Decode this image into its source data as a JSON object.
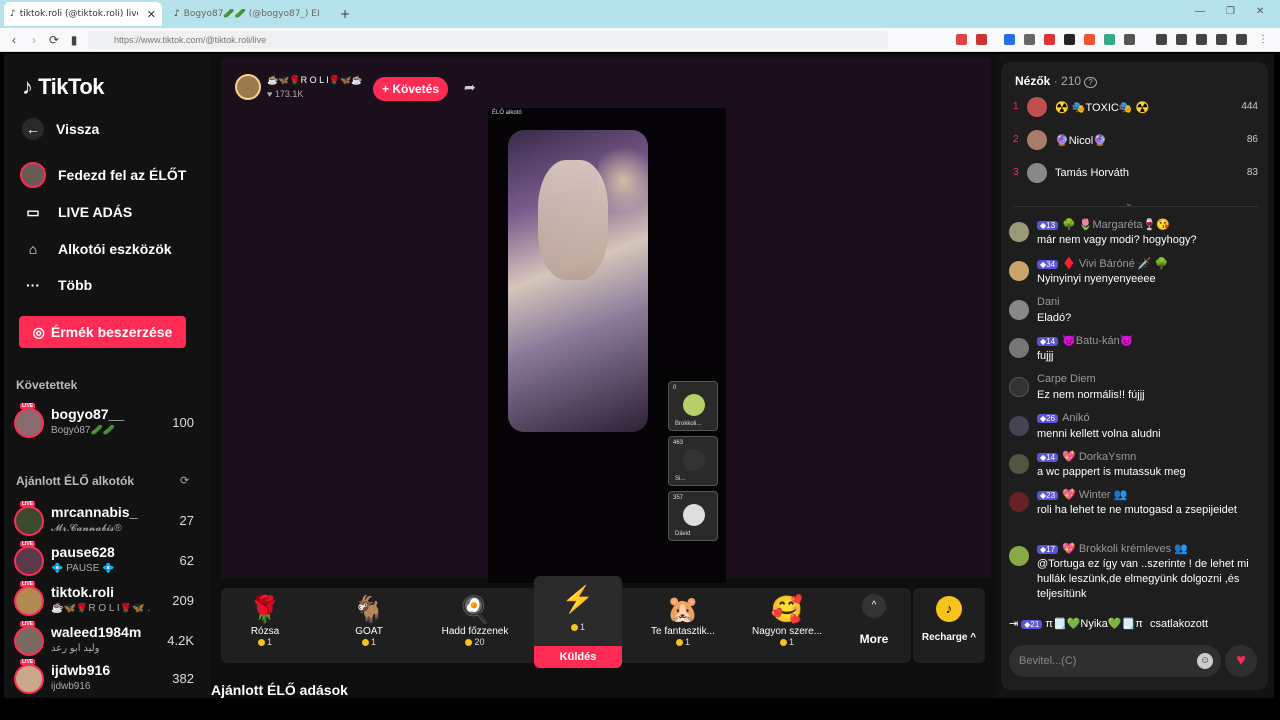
{
  "browser": {
    "tabs": [
      {
        "title": "tiktok.roli (@tiktok.roli) live",
        "close": "✕"
      },
      {
        "title": "Bogyo87🥒🥒 (@bogyo87_) ÉLŐ a"
      }
    ],
    "new_tab": "+",
    "url": "https://www.tiktok.com/@tiktok.roli/live"
  },
  "sidebar": {
    "logo": "TikTok",
    "back_label": "Vissza",
    "nav": [
      {
        "label": "Fedezd fel az ÉLŐT"
      },
      {
        "label": "LIVE ADÁS"
      },
      {
        "label": "Alkotói eszközök"
      },
      {
        "label": "Több"
      }
    ],
    "coin_button": "Érmék beszerzése",
    "following_title": "Követettek",
    "following": [
      {
        "name": "bogyo87__",
        "sub": "Bogyó87🥒🥒",
        "count": "100"
      }
    ],
    "recommended_title": "Ajánlott ÉLŐ alkotók",
    "recommended": [
      {
        "name": "mrcannabis_",
        "sub": "𝓜𝓻.𝓒𝓪𝓷𝓷𝓪𝓫𝓲𝓼®",
        "count": "27"
      },
      {
        "name": "pause628",
        "sub": "💠 PAUSE 💠",
        "count": "62"
      },
      {
        "name": "tiktok.roli",
        "sub": "☕🦋🌹R O L I🌹🦋 ...",
        "count": "209"
      },
      {
        "name": "waleed1984m",
        "sub": "وليد ابو رعد",
        "count": "4.2K"
      },
      {
        "name": "ijdwb916",
        "sub": "ijdwb916",
        "count": "382"
      }
    ]
  },
  "stream": {
    "host_name": "☕🦋🌹R O L I🌹🦋☕",
    "host_likes": "♥ 173.1K",
    "follow_label": "+ Követés",
    "video_label": "ÉLŐ alkotó",
    "guests": [
      {
        "count": "0",
        "name": "Brokkoli..."
      },
      {
        "count": "463",
        "name": "Si..."
      },
      {
        "count": "357",
        "name": "Dávid"
      }
    ],
    "gifts": [
      {
        "name": "Rózsa",
        "price": "1",
        "icon": "🌹"
      },
      {
        "name": "GOAT",
        "price": "1",
        "icon": "🐐"
      },
      {
        "name": "Hadd főzzenek",
        "price": "20",
        "icon": "🍳"
      },
      {
        "name": "",
        "price": "1",
        "icon": "⚡"
      },
      {
        "name": "Te fantasztik...",
        "price": "1",
        "icon": "🐹"
      },
      {
        "name": "Nagyon szere...",
        "price": "1",
        "icon": "🥰"
      }
    ],
    "send_label": "Küldés",
    "more_label": "More",
    "recharge_label": "Recharge ^",
    "recommended_title": "Ajánlott ÉLŐ adások"
  },
  "viewers": {
    "title": "Nézők",
    "count": "· 210",
    "list": [
      {
        "rank": "1",
        "name": "☢️ 🎭TOXIC🎭 ☢️",
        "score": "444",
        "color": "#c0504d"
      },
      {
        "rank": "2",
        "name": "🔮Nicol🔮",
        "score": "86",
        "color": "#a87b6a"
      },
      {
        "rank": "3",
        "name": "Tamás Horváth",
        "score": "83",
        "color": "#888"
      }
    ]
  },
  "comments": [
    {
      "level": "13",
      "user": "🌳 🌷Margaréta🍷😘",
      "text": "már nem vagy modi? hogyhogy?",
      "color": "#9a9a7a"
    },
    {
      "level": "34",
      "user": "♦️ Vivi Báróné 🗡️ 🌳",
      "text": "Nyinyinyi nyenyenyeeee",
      "color": "#c9a46b"
    },
    {
      "level": "",
      "user": "Dani",
      "text": "Eladó?",
      "color": "#888"
    },
    {
      "level": "14",
      "user": "😈Batu-kán😈",
      "text": "fujjj",
      "color": "#777"
    },
    {
      "level": "",
      "user": "Carpe Diem",
      "text": "Ez nem normális!! fújjj",
      "color": "#333"
    },
    {
      "level": "26",
      "user": "Anikó",
      "text": "menni kellett volna aludni",
      "color": "#445"
    },
    {
      "level": "14",
      "user": "💖 DorkaYsmn",
      "text": "a wc pappert is mutassuk meg",
      "color": "#554"
    },
    {
      "level": "23",
      "user": "💖 Winter 👥",
      "text": "roli ha lehet te ne mutogasd a zsepijeidet",
      "color": "#622"
    },
    {
      "level": "17",
      "user": "💖 Brokkoli krémleves 👥",
      "text": "@Tortuga ez így van ..szerinte ! de lehet mi hullák leszünk,de elmegyünk dolgozni ,és teljesítünk",
      "color": "#8a4"
    }
  ],
  "joined": {
    "level": "21",
    "user": "π🗒️💚Nyika💚🗒️π",
    "text": "csatlakozott"
  },
  "input_placeholder": "Bevitel...(C)"
}
